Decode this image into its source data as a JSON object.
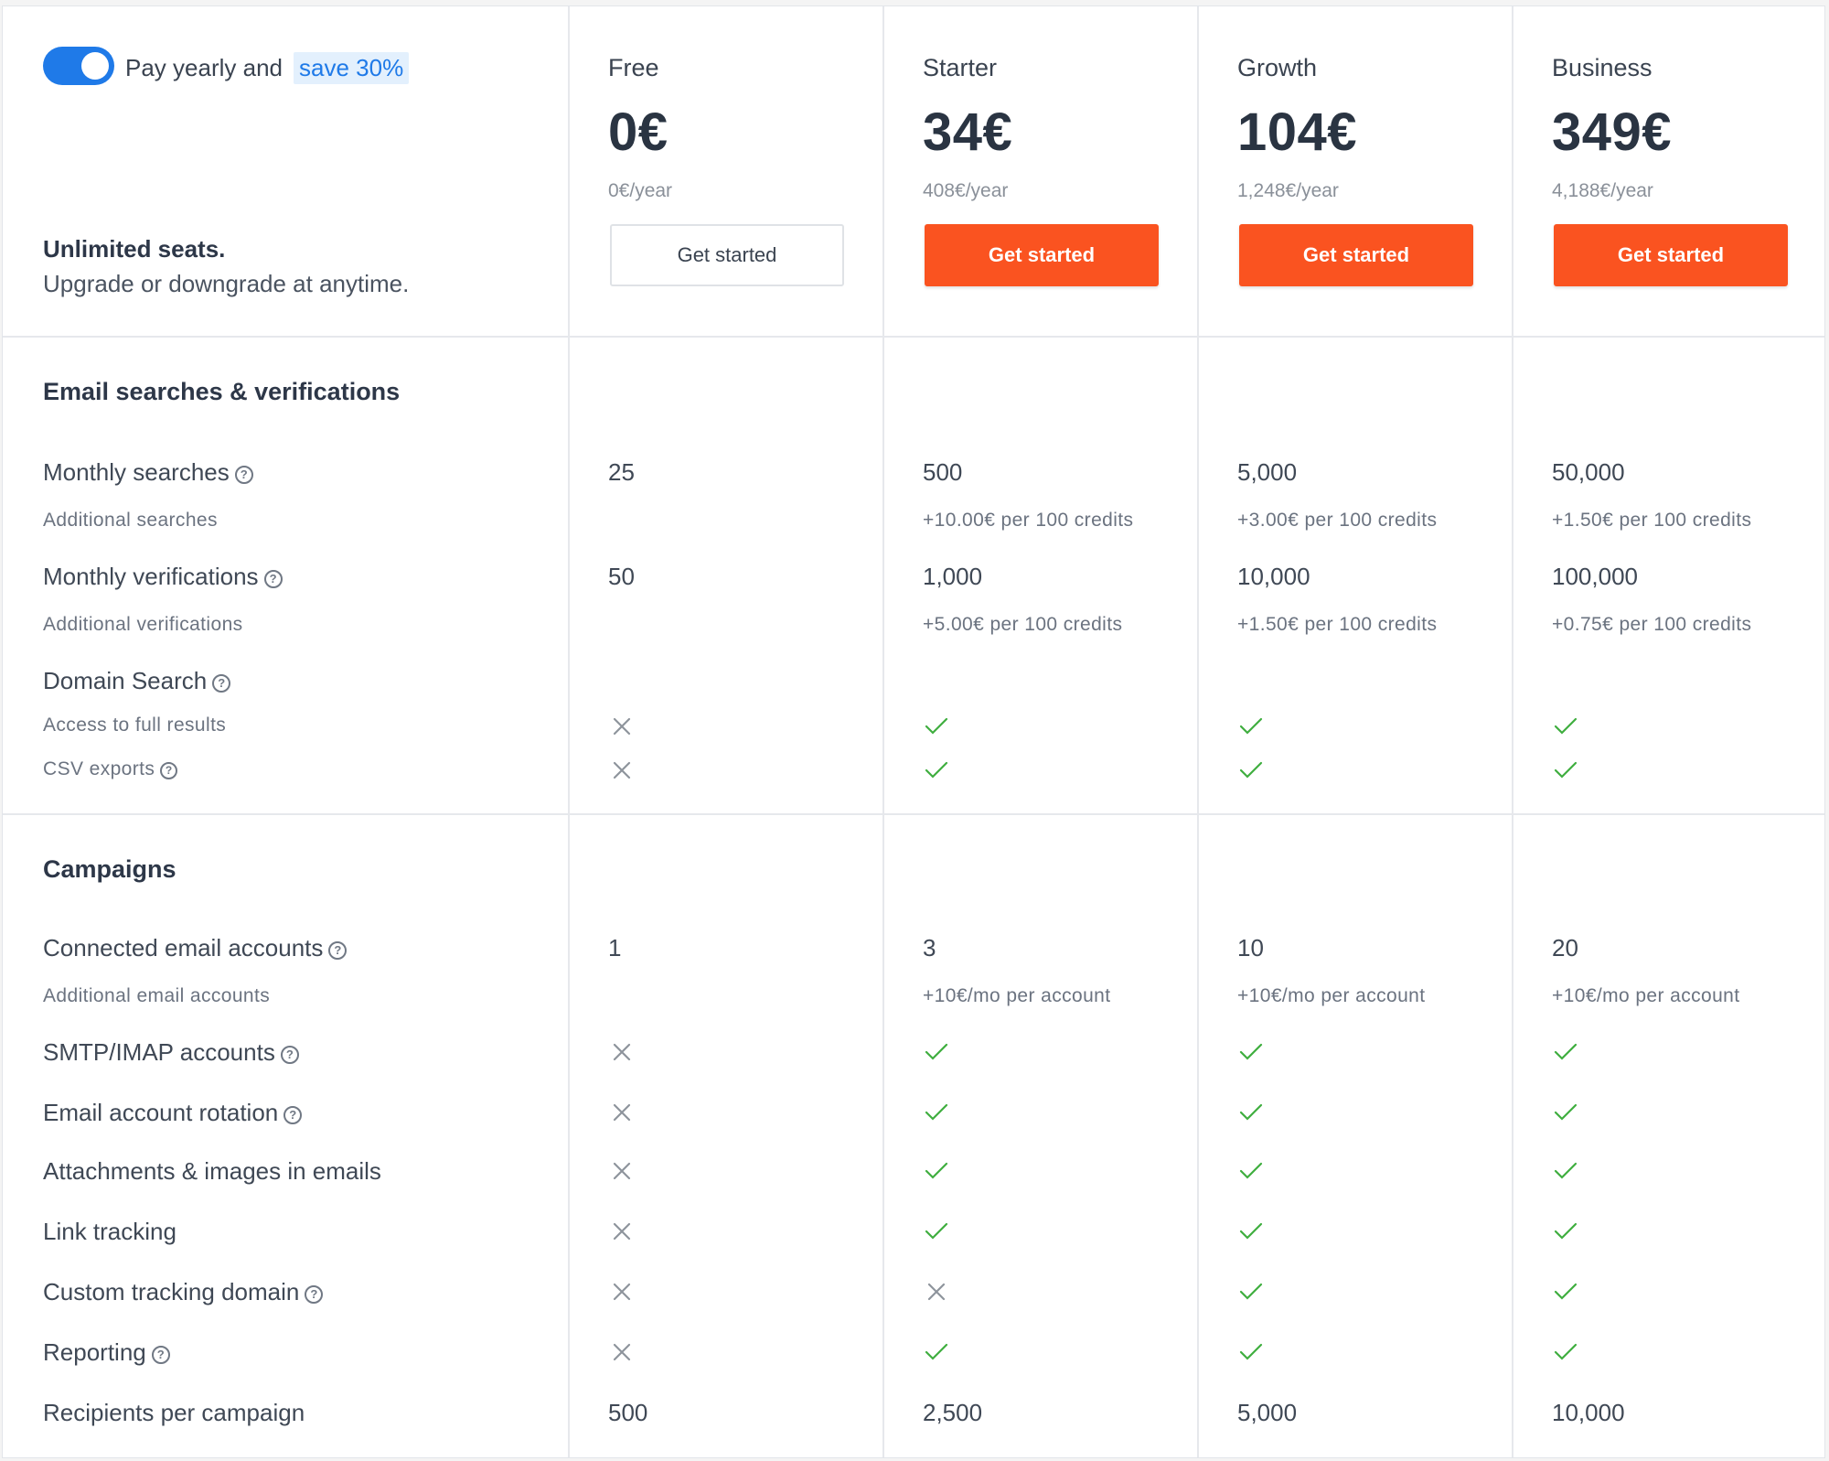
{
  "header": {
    "toggle_text": "Pay yearly and",
    "save_text": "save 30%",
    "toggle_on": true,
    "seats_title": "Unlimited seats.",
    "seats_subtitle": "Upgrade or downgrade at anytime."
  },
  "plans": [
    {
      "name": "Free",
      "price": "0€",
      "yearly": "0€/year",
      "cta": "Get started",
      "style": "outline"
    },
    {
      "name": "Starter",
      "price": "34€",
      "yearly": "408€/year",
      "cta": "Get started",
      "style": "filled"
    },
    {
      "name": "Growth",
      "price": "104€",
      "yearly": "1,248€/year",
      "cta": "Get started",
      "style": "filled"
    },
    {
      "name": "Business",
      "price": "349€",
      "yearly": "4,188€/year",
      "cta": "Get started",
      "style": "filled"
    }
  ],
  "sections": [
    {
      "title": "Email searches & verifications",
      "rows": [
        {
          "label": "Monthly searches",
          "help": true,
          "values": [
            "25",
            "500",
            "5,000",
            "50,000"
          ]
        },
        {
          "sublabel": "Additional searches",
          "values": [
            "",
            "+10.00€ per 100 credits",
            "+3.00€ per 100 credits",
            "+1.50€ per 100 credits"
          ]
        },
        {
          "label": "Monthly verifications",
          "help": true,
          "values": [
            "50",
            "1,000",
            "10,000",
            "100,000"
          ]
        },
        {
          "sublabel": "Additional verifications",
          "values": [
            "",
            "+5.00€ per 100 credits",
            "+1.50€ per 100 credits",
            "+0.75€ per 100 credits"
          ]
        },
        {
          "label": "Domain Search",
          "help": true,
          "values": [
            "",
            "",
            "",
            ""
          ]
        },
        {
          "sublabel": "Access to full results",
          "values": [
            "no",
            "yes",
            "yes",
            "yes"
          ]
        },
        {
          "sublabel": "CSV exports",
          "help": true,
          "values": [
            "no",
            "yes",
            "yes",
            "yes"
          ]
        }
      ]
    },
    {
      "title": "Campaigns",
      "rows": [
        {
          "label": "Connected email accounts",
          "help": true,
          "values": [
            "1",
            "3",
            "10",
            "20"
          ]
        },
        {
          "sublabel": "Additional email accounts",
          "values": [
            "",
            "+10€/mo per account",
            "+10€/mo per account",
            "+10€/mo per account"
          ]
        },
        {
          "label": "SMTP/IMAP accounts",
          "help": true,
          "values": [
            "no",
            "yes",
            "yes",
            "yes"
          ]
        },
        {
          "label": "Email account rotation",
          "help": true,
          "values": [
            "no",
            "yes",
            "yes",
            "yes"
          ]
        },
        {
          "label": "Attachments & images in emails",
          "help": false,
          "values": [
            "no",
            "yes",
            "yes",
            "yes"
          ]
        },
        {
          "label": "Link tracking",
          "help": false,
          "values": [
            "no",
            "yes",
            "yes",
            "yes"
          ]
        },
        {
          "label": "Custom tracking domain",
          "help": true,
          "values": [
            "no",
            "no",
            "yes",
            "yes"
          ]
        },
        {
          "label": "Reporting",
          "help": true,
          "values": [
            "no",
            "yes",
            "yes",
            "yes"
          ]
        },
        {
          "label": "Recipients per campaign",
          "help": false,
          "values": [
            "500",
            "2,500",
            "5,000",
            "10,000"
          ]
        }
      ]
    }
  ],
  "icons": {
    "help": "question-circle-icon",
    "yes": "check-icon",
    "no": "cross-icon"
  },
  "colors": {
    "accent": "#1f7ae8",
    "cta": "#fa5320",
    "check": "#3fae3f",
    "cross": "#8e949c"
  }
}
